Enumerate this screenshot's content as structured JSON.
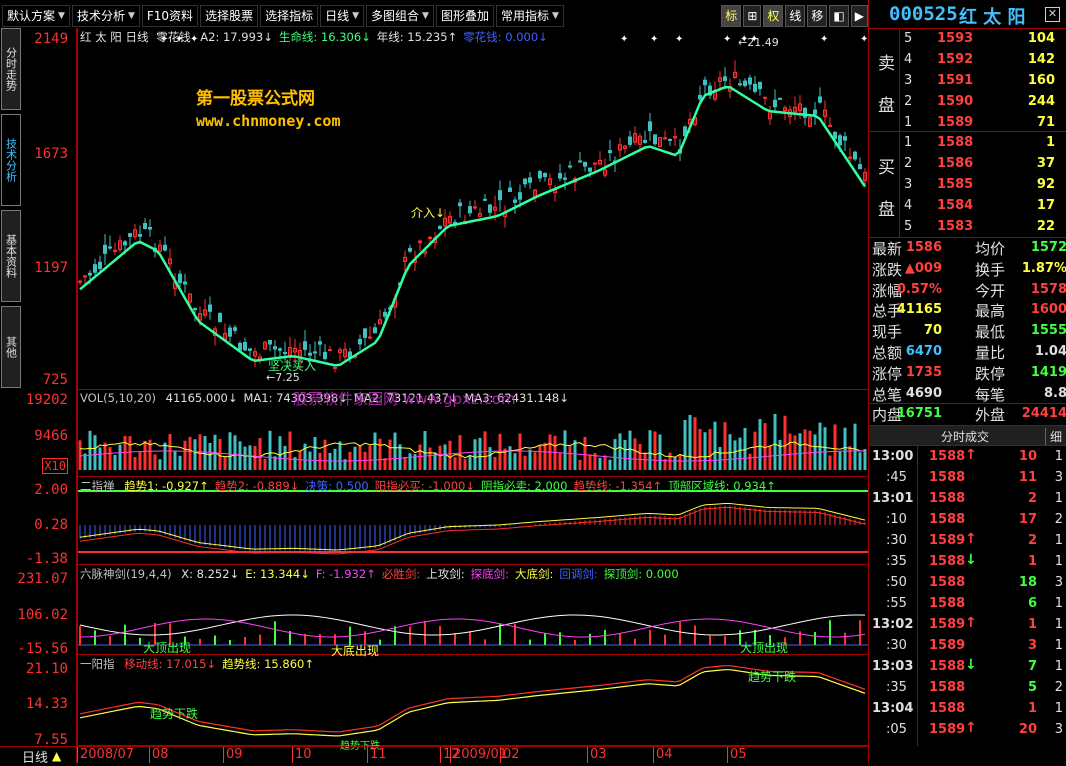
{
  "toolbar": {
    "items": [
      {
        "label": "默认方案",
        "arrow": true
      },
      {
        "label": "技术分析",
        "arrow": true
      },
      {
        "label": "F10资料",
        "arrow": false
      },
      {
        "label": "选择股票",
        "arrow": false
      },
      {
        "label": "选择指标",
        "arrow": false
      },
      {
        "label": "日线",
        "arrow": true
      },
      {
        "label": "多图组合",
        "arrow": true
      },
      {
        "label": "图形叠加",
        "arrow": false
      },
      {
        "label": "常用指标",
        "arrow": true
      }
    ],
    "right_buttons": [
      "标",
      "⊞",
      "权",
      "线",
      "移",
      "◧",
      "▶"
    ]
  },
  "left_tabs": [
    "分时走势",
    "技术分析",
    "基本资料",
    "其他"
  ],
  "stock": {
    "code": "000525",
    "name": "红 太 阳"
  },
  "main": {
    "title": "红 太 阳 日线",
    "indicator": "零花钱",
    "legend": [
      {
        "text": "A2: 17.993↓",
        "color": "#e0e0e0"
      },
      {
        "text": "生命线: 16.306↓",
        "color": "#40ff80"
      },
      {
        "text": "年线: 15.235↑",
        "color": "#e0e0e0"
      },
      {
        "text": "零花钱: 0.000↓",
        "color": "#4060ff"
      }
    ],
    "y_labels": [
      "2149",
      "1673",
      "1197",
      "725"
    ],
    "watermark_cn": "第一股票公式网",
    "watermark_url": "www.chnmoney.com",
    "ann_high": "←21.49",
    "ann_low": "←7.25",
    "ann_buy": "坚决买入",
    "ann_enter": "介入↓"
  },
  "vol": {
    "title": "VOL(5,10,20)",
    "legend": [
      {
        "text": "41165.000↓",
        "color": "#e0e0e0"
      },
      {
        "text": "MA1: 74303.398↓",
        "color": "#e0e0e0"
      },
      {
        "text": "MA2: 73121.437↓",
        "color": "#e0e0e0"
      },
      {
        "text": "MA3: 62431.148↓",
        "color": "#e0e0e0"
      }
    ],
    "y_labels": [
      "19202",
      "9466"
    ],
    "unit": "X10",
    "watermark": "股票软件家园网 www.gpxz.com"
  },
  "ind2": {
    "title": "二指禅",
    "legend": [
      {
        "text": "趋势1: -0.927↑",
        "color": "#ffff40"
      },
      {
        "text": "趋势2: -0.889↓",
        "color": "#ff4040"
      },
      {
        "text": "决策: 0.500",
        "color": "#4060ff"
      },
      {
        "text": "阳指必买: -1.000↓",
        "color": "#ff4040"
      },
      {
        "text": "阴指必卖: 2.000",
        "color": "#40ff40"
      },
      {
        "text": "趋势线: -1.354↑",
        "color": "#ff4040"
      },
      {
        "text": "顶部区域线: 0.934↑",
        "color": "#40ff40"
      }
    ],
    "y_labels": [
      "2.00",
      "0.28",
      "-1.38"
    ]
  },
  "ind3": {
    "title": "六脉神剑(19,4,4)",
    "legend": [
      {
        "text": "X: 8.252↓",
        "color": "#e0e0e0"
      },
      {
        "text": "E: 13.344↓",
        "color": "#ffff40"
      },
      {
        "text": "F: -1.932↑",
        "color": "#ff40ff"
      },
      {
        "text": "必胜剑:",
        "color": "#ff4040"
      },
      {
        "text": "上攻剑:",
        "color": "#e0e0e0"
      },
      {
        "text": "探底剑:",
        "color": "#ff40ff"
      },
      {
        "text": "大底剑:",
        "color": "#ffff40"
      },
      {
        "text": "回调剑:",
        "color": "#4060ff"
      },
      {
        "text": "探顶剑: 0.000",
        "color": "#40ff40"
      }
    ],
    "y_labels": [
      "231.07",
      "106.02",
      "-15.56"
    ],
    "ann": [
      "大顶出现",
      "大底出现",
      "大顶出现"
    ]
  },
  "ind4": {
    "title": "一阳指",
    "legend": [
      {
        "text": "移动线: 17.015↓",
        "color": "#ff4040"
      },
      {
        "text": "趋势线: 15.860↑",
        "color": "#ffff40"
      }
    ],
    "y_labels": [
      "21.10",
      "14.33",
      "7.55"
    ],
    "ann": [
      "趋势下跌",
      "趋势下跌",
      "趋势下跌"
    ]
  },
  "xaxis": {
    "period": "日线",
    "labels": [
      "2008/07",
      "08",
      "09",
      "10",
      "11",
      "12",
      "2009/01",
      "02",
      "03",
      "04",
      "05"
    ]
  },
  "orderbook": {
    "sell_label": [
      "卖",
      "盘"
    ],
    "buy_label": [
      "买",
      "盘"
    ],
    "sell": [
      {
        "lv": "5",
        "p": "1593",
        "v": "104"
      },
      {
        "lv": "4",
        "p": "1592",
        "v": "142"
      },
      {
        "lv": "3",
        "p": "1591",
        "v": "160"
      },
      {
        "lv": "2",
        "p": "1590",
        "v": "244"
      },
      {
        "lv": "1",
        "p": "1589",
        "v": "71"
      }
    ],
    "buy": [
      {
        "lv": "1",
        "p": "1588",
        "v": "1"
      },
      {
        "lv": "2",
        "p": "1586",
        "v": "37"
      },
      {
        "lv": "3",
        "p": "1585",
        "v": "92"
      },
      {
        "lv": "4",
        "p": "1584",
        "v": "17"
      },
      {
        "lv": "5",
        "p": "1583",
        "v": "22"
      }
    ]
  },
  "quote": [
    {
      "l": "最新",
      "v": "1586",
      "vc": "#ff4040",
      "l2": "均价",
      "v2": "1572",
      "v2c": "#40ff40"
    },
    {
      "l": "涨跌",
      "v": "▲009",
      "vc": "#ff4040",
      "l2": "换手",
      "v2": "1.87%",
      "v2c": "#ffff40"
    },
    {
      "l": "涨幅",
      "v": "0.57%",
      "vc": "#ff4040",
      "l2": "今开",
      "v2": "1578",
      "v2c": "#ff4040"
    },
    {
      "l": "总手",
      "v": "41165",
      "vc": "#ffff40",
      "l2": "最高",
      "v2": "1600",
      "v2c": "#ff4040"
    },
    {
      "l": "现手",
      "v": "70",
      "vc": "#ffff40",
      "l2": "最低",
      "v2": "1555",
      "v2c": "#40ff40"
    },
    {
      "l": "总额",
      "v": "6470",
      "vc": "#40c0ff",
      "l2": "量比",
      "v2": "1.04",
      "v2c": "#e0e0e0"
    },
    {
      "l": "涨停",
      "v": "1735",
      "vc": "#ff4040",
      "l2": "跌停",
      "v2": "1419",
      "v2c": "#40ff40"
    },
    {
      "l": "总笔",
      "v": "4690",
      "vc": "#e0e0e0",
      "l2": "每笔",
      "v2": "8.8",
      "v2c": "#e0e0e0"
    },
    {
      "l": "内盘",
      "v": "16751",
      "vc": "#40ff40",
      "l2": "外盘",
      "v2": "24414",
      "v2c": "#ff4040"
    }
  ],
  "ticks_header": {
    "title": "分时成交",
    "btn": "细"
  },
  "ticks": [
    {
      "t": "13:00",
      "p": "1588",
      "a": "↑",
      "v": "10",
      "n": "1"
    },
    {
      "t": ":45",
      "p": "1588",
      "a": "",
      "v": "11",
      "n": "3"
    },
    {
      "t": "13:01",
      "p": "1588",
      "a": "",
      "v": "2",
      "n": "1"
    },
    {
      "t": ":10",
      "p": "1588",
      "a": "",
      "v": "17",
      "n": "2"
    },
    {
      "t": ":30",
      "p": "1589",
      "a": "↑",
      "v": "2",
      "n": "1"
    },
    {
      "t": ":35",
      "p": "1588",
      "a": "↓",
      "v": "1",
      "n": "1"
    },
    {
      "t": ":50",
      "p": "1588",
      "a": "",
      "v": "18",
      "n": "3"
    },
    {
      "t": ":55",
      "p": "1588",
      "a": "",
      "v": "6",
      "n": "1"
    },
    {
      "t": "13:02",
      "p": "1589",
      "a": "↑",
      "v": "1",
      "n": "1"
    },
    {
      "t": ":30",
      "p": "1589",
      "a": "",
      "v": "3",
      "n": "1"
    },
    {
      "t": "13:03",
      "p": "1588",
      "a": "↓",
      "v": "7",
      "n": "1"
    },
    {
      "t": ":35",
      "p": "1588",
      "a": "",
      "v": "5",
      "n": "2"
    },
    {
      "t": "13:04",
      "p": "1588",
      "a": "",
      "v": "1",
      "n": "1"
    },
    {
      "t": ":05",
      "p": "1589",
      "a": "↑",
      "v": "20",
      "n": "3"
    }
  ]
}
